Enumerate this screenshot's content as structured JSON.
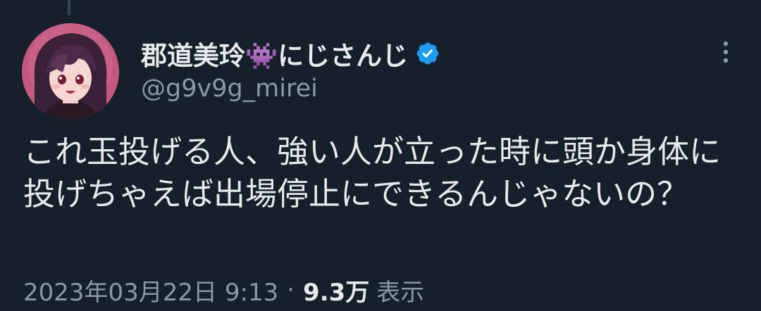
{
  "tweet": {
    "display_name": "郡道美玲👾にじさんじ",
    "handle": "@g9v9g_mirei",
    "text": "これ玉投げる人、強い人が立った時に頭か身体に投げちゃえば出場停止にできるんじゃないの？",
    "timestamp": "2023年03月22日 9:13",
    "separator": "·",
    "views_count": "9.3万",
    "views_label": "表示"
  },
  "icons": {
    "verified": "verified-badge-icon",
    "more": "more-options-icon"
  },
  "colors": {
    "background": "#15202b",
    "primary_text": "#e7e9ea",
    "secondary_text": "#8b98a5",
    "verified_blue": "#1d9bf0"
  }
}
